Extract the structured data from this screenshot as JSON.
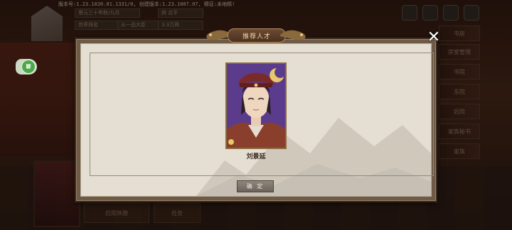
{
  "header": {
    "version_text": "版本号:1.23.1020.01.1331/0, 创建版本:1.23.1007.07, 精征:未地精!"
  },
  "player_info": {
    "date_text": "景元三十年秋/九月",
    "rank_text": "世界排名",
    "rank_value": "从一品大臣",
    "money_text": "3.3万两",
    "stat_a": "北平",
    "label_a": "府"
  },
  "side_menu": {
    "items": [
      "书房",
      "宗室管理",
      "书院",
      "东院",
      "后院",
      "家族秘书",
      "家族"
    ]
  },
  "green_badge": {
    "label": "聊"
  },
  "dialog": {
    "title": "推荐人才",
    "character_name": "刘景延",
    "confirm_label": "确 定",
    "close_symbol": "✕"
  },
  "bottom": {
    "btn1": "后院休憩",
    "btn2": "任务"
  },
  "colors": {
    "dialog_border": "#6e5a47",
    "paper": "#e5dfd3",
    "portrait_bg": "#5a3a8a"
  }
}
